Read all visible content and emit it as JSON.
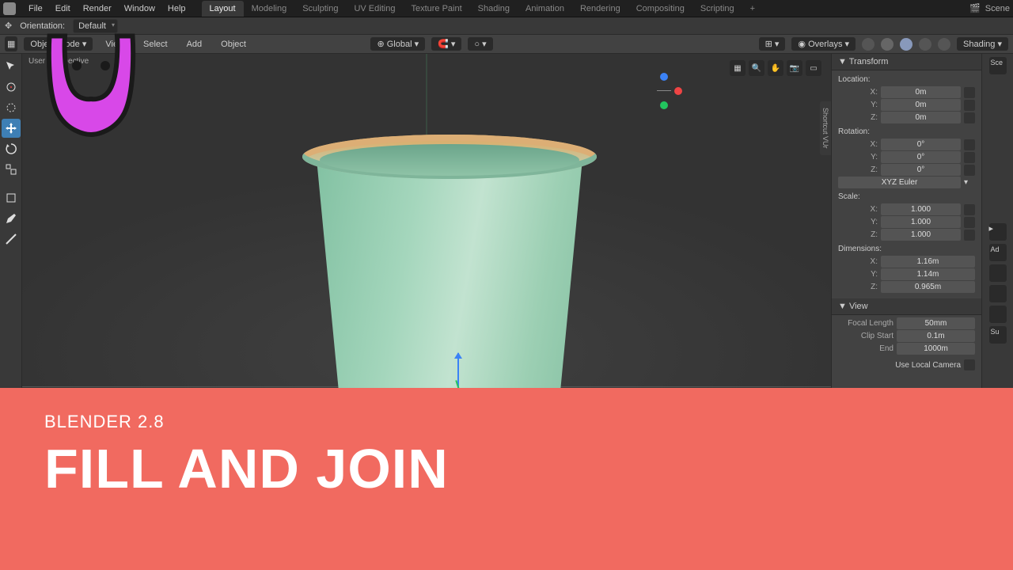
{
  "topbar": {
    "menus": [
      "File",
      "Edit",
      "Render",
      "Window",
      "Help"
    ]
  },
  "workspaces": [
    "Layout",
    "Modeling",
    "Sculpting",
    "UV Editing",
    "Texture Paint",
    "Shading",
    "Animation",
    "Rendering",
    "Compositing",
    "Scripting"
  ],
  "active_workspace": "Layout",
  "scene_label": "Scene",
  "toolbar2": {
    "orientation_label": "Orientation:",
    "default": "Default"
  },
  "toolbar3": {
    "mode": "Object Mode",
    "view": "View",
    "select": "Select",
    "add": "Add",
    "object": "Object",
    "global": "Global"
  },
  "view_info": "User Perspective",
  "overlays_label": "Overlays",
  "shading_label": "Shading",
  "transform": {
    "header": "Transform",
    "location_label": "Location:",
    "location": {
      "x": "0m",
      "y": "0m",
      "z": "0m"
    },
    "rotation_label": "Rotation:",
    "rotation": {
      "x": "0°",
      "y": "0°",
      "z": "0°"
    },
    "rotation_mode": "XYZ Euler",
    "scale_label": "Scale:",
    "scale": {
      "x": "1.000",
      "y": "1.000",
      "z": "1.000"
    },
    "dimensions_label": "Dimensions:",
    "dimensions": {
      "x": "1.16m",
      "y": "1.14m",
      "z": "0.965m"
    }
  },
  "view_panel": {
    "header": "View",
    "focal_label": "Focal Length",
    "focal": "50mm",
    "clip_start_label": "Clip Start",
    "clip_start": "0.1m",
    "clip_end_label": "End",
    "clip_end": "1000m",
    "use_local": "Use Local Camera"
  },
  "vertical_tab": "Shortcut VUr",
  "outliner": {
    "scene": "Sce",
    "add": "Ad",
    "su": "Su"
  },
  "banner": {
    "sub": "BLENDER 2.8",
    "title": "FILL AND JOIN"
  },
  "axis": {
    "x": "X:",
    "y": "Y:",
    "z": "Z:"
  }
}
